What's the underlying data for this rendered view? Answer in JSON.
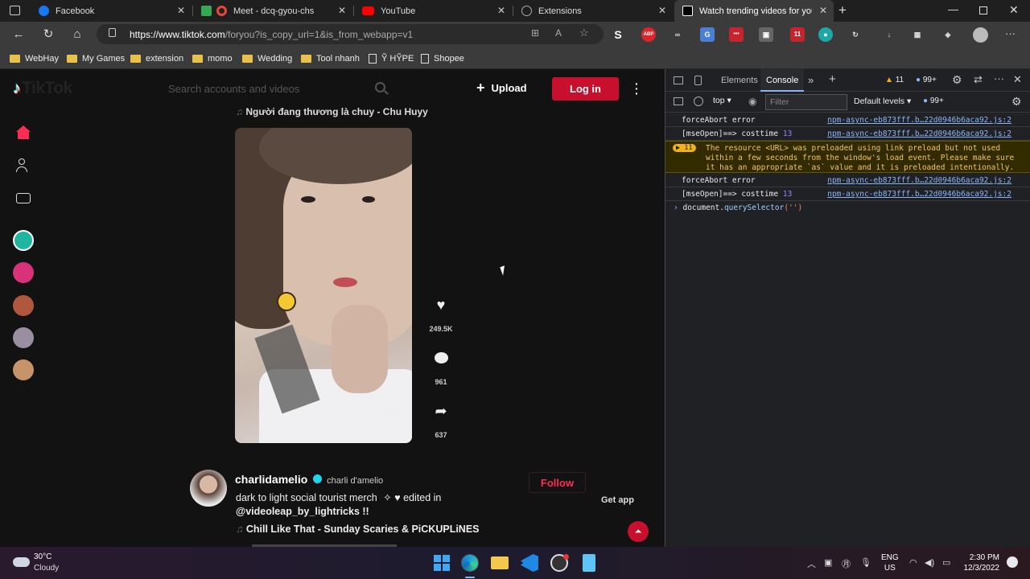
{
  "browser": {
    "tabs": [
      {
        "title": "Facebook",
        "color": "#1877f2"
      },
      {
        "title": "Meet - dcq-gyou-chs",
        "color": "#e8453c"
      },
      {
        "title": "YouTube",
        "color": "#ff0000"
      },
      {
        "title": "Extensions",
        "color": "#999999"
      },
      {
        "title": "Watch trending videos for you |",
        "color": "#ffffff"
      }
    ],
    "url_host": "https://www.tiktok.com",
    "url_path": "/foryou?is_copy_url=1&is_from_webapp=v1",
    "extensions": [
      "S",
      "ABP",
      "∞",
      "G",
      "•••",
      "▣",
      "11",
      "●",
      "↻",
      "↓",
      "▦",
      "◈"
    ],
    "bookmarks": [
      {
        "label": "WebHay",
        "type": "folder"
      },
      {
        "label": "My Games",
        "type": "folder"
      },
      {
        "label": "extension",
        "type": "folder"
      },
      {
        "label": "momo",
        "type": "folder"
      },
      {
        "label": "Wedding",
        "type": "folder"
      },
      {
        "label": "Tool nhanh",
        "type": "folder"
      },
      {
        "label": "Ỹ HỸPE",
        "type": "page"
      },
      {
        "label": "Shopee",
        "type": "page"
      }
    ]
  },
  "tiktok": {
    "logo": "TikTok",
    "search_placeholder": "Search accounts and videos",
    "upload_label": "Upload",
    "login_label": "Log in",
    "song1": "Người đang thương là chuy - Chu Huyy",
    "likes": "249.5K",
    "comments": "961",
    "shares": "637",
    "post2": {
      "username": "charlidamelio",
      "display_name": "charli d'amelio",
      "caption": "dark to light social tourist merch",
      "caption_edit": "edited in",
      "caption_mention": "@videoleap_by_lightricks !!",
      "song": "Chill Like That - Sunday Scaries & PiCKUPLiNES",
      "follow_label": "Follow"
    },
    "get_app": "Get app"
  },
  "devtools": {
    "tabs": [
      "Elements",
      "Console"
    ],
    "warn_count": "11",
    "issue_count": "99+",
    "context": "top",
    "filter_placeholder": "Filter",
    "levels": "Default levels",
    "levels_count": "99+",
    "logs": [
      {
        "text": "forceAbort error",
        "num": "",
        "src": "npm-async-eb873fff.b…22d0946b6aca92.js:2",
        "type": "log"
      },
      {
        "text": "[mseOpen]==> costtime",
        "num": "13",
        "src": "npm-async-eb873fff.b…22d0946b6aca92.js:2",
        "type": "log"
      },
      {
        "text": "The resource <URL> was preloaded using link preload but not used within a few seconds from the window's load event. Please make sure it has an appropriate `as` value and it is preloaded intentionally.",
        "num": "11",
        "src": "",
        "type": "warn"
      },
      {
        "text": "forceAbort error",
        "num": "",
        "src": "npm-async-eb873fff.b…22d0946b6aca92.js:2",
        "type": "log"
      },
      {
        "text": "[mseOpen]==> costtime",
        "num": "13",
        "src": "npm-async-eb873fff.b…22d0946b6aca92.js:2",
        "type": "log"
      }
    ],
    "input_prefix": "document.",
    "input_method": "querySelector",
    "input_arg": "('')"
  },
  "taskbar": {
    "temp": "30°C",
    "weather": "Cloudy",
    "lang1": "ENG",
    "lang2": "US",
    "time": "2:30 PM",
    "date": "12/3/2022"
  }
}
